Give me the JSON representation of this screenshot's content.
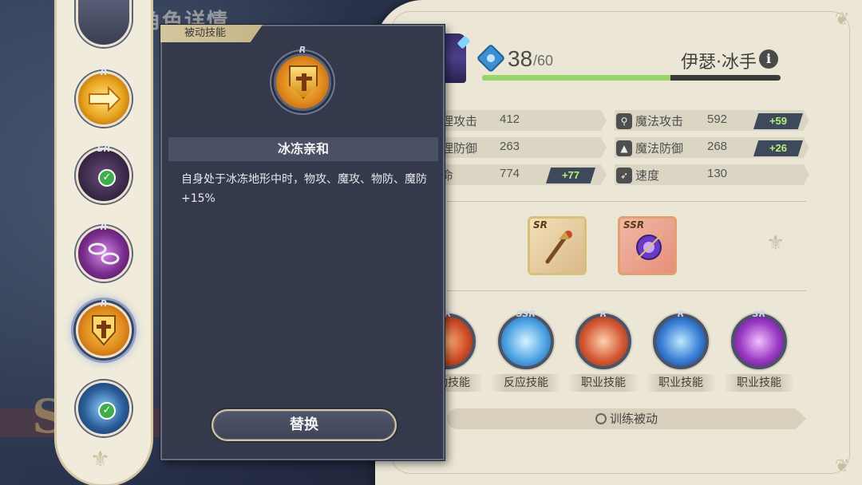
{
  "background": {
    "title": "角色详情",
    "emblem_letter": "S"
  },
  "hero": {
    "level": "38",
    "level_max": "/60",
    "name": "伊瑟·冰手",
    "exp_fraction": 0.63
  },
  "stats": [
    {
      "label": "物理攻击",
      "value": "412",
      "bonus": "",
      "icon": "sword-icon"
    },
    {
      "label": "魔法攻击",
      "value": "592",
      "bonus": "+59",
      "icon": "wand-icon"
    },
    {
      "label": "物理防御",
      "value": "263",
      "bonus": "",
      "icon": "shield-icon"
    },
    {
      "label": "魔法防御",
      "value": "268",
      "bonus": "+26",
      "icon": "hat-icon"
    },
    {
      "label": "生命",
      "value": "774",
      "bonus": "+77",
      "icon": "heart-icon"
    },
    {
      "label": "速度",
      "value": "130",
      "bonus": "",
      "icon": "wing-icon"
    }
  ],
  "equipment": [
    {
      "rarity": "SR",
      "icon": "staff-icon"
    },
    {
      "rarity": "SSR",
      "icon": "orb-icon"
    }
  ],
  "skills": [
    {
      "rarity": "R",
      "label": "主动技能",
      "icon": "fire-swirl-icon"
    },
    {
      "rarity": "SSR",
      "label": "反应技能",
      "icon": "dash-icon"
    },
    {
      "rarity": "R",
      "label": "职业技能",
      "icon": "fire-swirl-icon"
    },
    {
      "rarity": "R",
      "label": "职业技能",
      "icon": "ice-crystal-icon"
    },
    {
      "rarity": "SR",
      "label": "职业技能",
      "icon": "mask-icon"
    }
  ],
  "train_label": "训练被动",
  "skill_list": [
    {
      "rarity": "",
      "checked": false,
      "icon": "partial-skill-icon"
    },
    {
      "rarity": "R",
      "checked": false,
      "icon": "arrow-dash-icon"
    },
    {
      "rarity": "SR",
      "checked": true,
      "icon": "dark-mask-icon"
    },
    {
      "rarity": "R",
      "checked": false,
      "icon": "chain-icon"
    },
    {
      "rarity": "R",
      "checked": false,
      "icon": "golden-shield-icon",
      "selected": true
    },
    {
      "rarity": "",
      "checked": true,
      "icon": "ice-circle-icon"
    }
  ],
  "popup": {
    "tab_label": "被动技能",
    "skill_rarity": "R",
    "skill_name": "冰冻亲和",
    "description": "自身处于冰冻地形中时，物攻、魔攻、物防、魔防+15%",
    "button_label": "替换"
  },
  "colors": {
    "popup_bg": "#343a4c",
    "parchment": "#ece6d6",
    "bonus_text": "#b6f07a",
    "check_green": "#3eae4a",
    "exp_fill": "#9bd46a"
  }
}
